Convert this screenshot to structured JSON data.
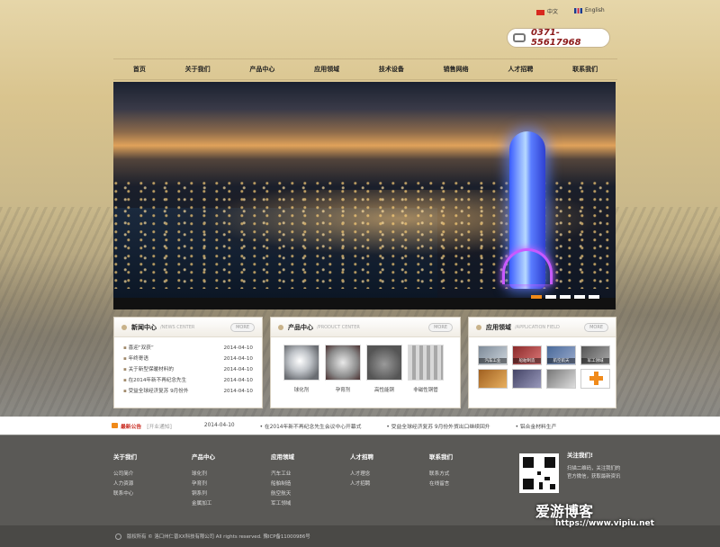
{
  "lang": {
    "zh": "中文",
    "en": "English"
  },
  "phone": "0371-55617968",
  "nav": [
    "首页",
    "关于我们",
    "产品中心",
    "应用领域",
    "技术设备",
    "销售网络",
    "人才招聘",
    "联系我们"
  ],
  "news": {
    "title": "新闻中心",
    "en": "/NEWS CENTER",
    "more": "MORE",
    "items": [
      {
        "text": "喜迎“双获”",
        "date": "2014-04-10"
      },
      {
        "text": "年终寄语",
        "date": "2014-04-10"
      },
      {
        "text": "关于新型保暖材料的",
        "date": "2014-04-10"
      },
      {
        "text": "在2014年新不再纪念先生",
        "date": "2014-04-10"
      },
      {
        "text": "受益全球经济复苏 9月份外",
        "date": "2014-04-10"
      }
    ]
  },
  "products": {
    "title": "产品中心",
    "en": "/PRODUCT CENTER",
    "more": "MORE",
    "items": [
      "球化剂",
      "孕育剂",
      "高性能铜",
      "非磁性铜管"
    ]
  },
  "applications": {
    "title": "应用领域",
    "en": "/APPLICATION FIELD",
    "more": "MORE",
    "tiles": [
      "汽车工业",
      "船舶制造",
      "航空航天",
      "军工领域",
      "",
      "",
      "",
      ""
    ]
  },
  "ticker": {
    "label": "最新公告",
    "sub": "[开业通知]",
    "date": "2014-04-10",
    "items": [
      "在2014年新不再纪念先生会议中心开幕式",
      "受益全球经济复苏 9月份外贸出口继续回升",
      "铝合金材料生产"
    ]
  },
  "footer": {
    "cols": [
      {
        "title": "关于我们",
        "items": [
          "公司简介",
          "人力资源",
          "联系中心"
        ]
      },
      {
        "title": "产品中心",
        "items": [
          "球化剂",
          "孕育剂",
          "铜系列",
          "金属加工"
        ]
      },
      {
        "title": "应用领域",
        "items": [
          "汽车工业",
          "船舶制造",
          "航空航天",
          "军工领域"
        ]
      },
      {
        "title": "人才招聘",
        "items": [
          "人才理念",
          "人才招聘"
        ]
      },
      {
        "title": "联系我们",
        "items": [
          "联系方式",
          "在线留言"
        ]
      }
    ],
    "follow_title": "关注我们!",
    "follow_text": "扫描二维码，关注我们的官方微信，获取最新资讯"
  },
  "copyright": "版权所有 © 洛口州仁普XX科技有限公司  All rights reserved.  豫ICP备11000986号",
  "watermark": {
    "main": "爱游博客",
    "sub": "https://www.vipiu.net"
  }
}
